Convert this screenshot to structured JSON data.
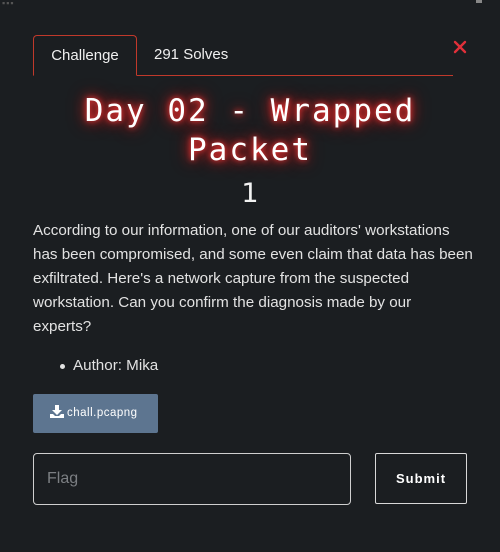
{
  "tabs": [
    {
      "label": "Challenge",
      "active": true
    },
    {
      "label": "291 Solves",
      "active": false
    }
  ],
  "challenge": {
    "title": "Day 02 - Wrapped Packet",
    "points": "1",
    "description": "According to our information, one of our auditors' workstations has been compromised, and some even claim that data has been exfiltrated. Here's a network capture from the suspected workstation. Can you confirm the diagnosis made by our experts?",
    "author": "Author: Mika",
    "file_label": "chall.pcapng"
  },
  "form": {
    "flag_placeholder": "Flag",
    "flag_value": "",
    "submit_label": "Submit"
  },
  "icons": {
    "close": "close-icon",
    "download": "download-icon"
  },
  "colors": {
    "accent": "#c0392b",
    "close": "#e0303a",
    "file_button": "#5d7590",
    "title_glow": "#ff3b3b",
    "modal_bg": "#1b1e21"
  }
}
